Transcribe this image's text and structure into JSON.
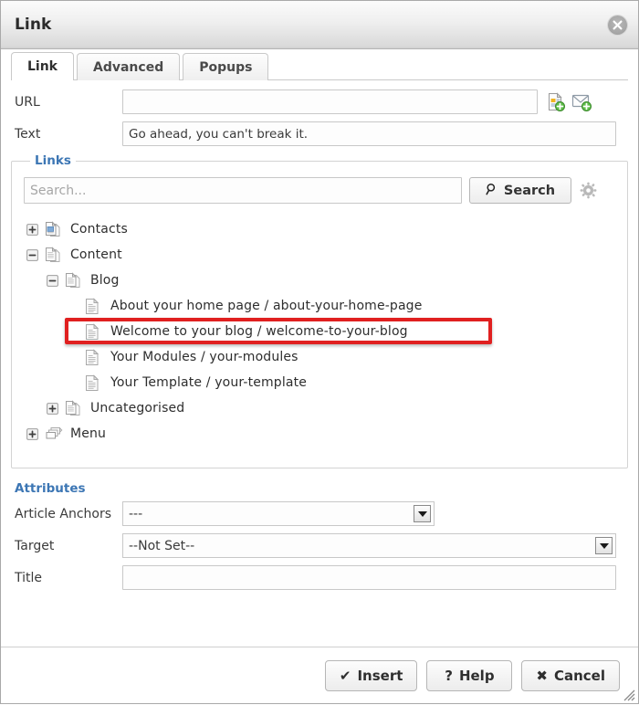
{
  "window": {
    "title": "Link",
    "close_icon": "close-circle-icon",
    "resize_grip_icon": "resize-grip-icon"
  },
  "tabs": [
    {
      "label": "Link",
      "active": true
    },
    {
      "label": "Advanced",
      "active": false
    },
    {
      "label": "Popups",
      "active": false
    }
  ],
  "form": {
    "url": {
      "label": "URL",
      "value": "",
      "placeholder": "",
      "icons": [
        {
          "name": "insert-article-icon"
        },
        {
          "name": "insert-email-icon"
        }
      ]
    },
    "text": {
      "label": "Text",
      "value": "Go ahead, you can't break it.",
      "placeholder": ""
    }
  },
  "links_panel": {
    "legend": "Links",
    "search": {
      "value": "",
      "placeholder": "Search...",
      "button_label": "Search",
      "button_icon": "magnifier-icon",
      "options_icon": "gear-icon"
    },
    "tree": [
      {
        "level": 0,
        "label": "Contacts",
        "toggle": "plus",
        "icon": "contacts-stack-icon",
        "highlighted": false
      },
      {
        "level": 0,
        "label": "Content",
        "toggle": "minus",
        "icon": "content-stack-icon",
        "highlighted": false
      },
      {
        "level": 1,
        "label": "Blog",
        "toggle": "minus",
        "icon": "content-stack-icon",
        "highlighted": false
      },
      {
        "level": 2,
        "label": "About your home page / about-your-home-page",
        "toggle": "none",
        "icon": "article-page-icon",
        "highlighted": false
      },
      {
        "level": 2,
        "label": "Welcome to your blog / welcome-to-your-blog",
        "toggle": "none",
        "icon": "article-page-icon",
        "highlighted": true
      },
      {
        "level": 2,
        "label": "Your Modules / your-modules",
        "toggle": "none",
        "icon": "article-page-icon",
        "highlighted": false
      },
      {
        "level": 2,
        "label": "Your Template / your-template",
        "toggle": "none",
        "icon": "article-page-icon",
        "highlighted": false
      },
      {
        "level": 1,
        "label": "Uncategorised",
        "toggle": "plus",
        "icon": "content-stack-icon",
        "highlighted": false
      },
      {
        "level": 0,
        "label": "Menu",
        "toggle": "plus",
        "icon": "menu-stack-icon",
        "highlighted": false
      }
    ]
  },
  "attributes": {
    "title": "Attributes",
    "article_anchors": {
      "label": "Article Anchors",
      "value": "---"
    },
    "target": {
      "label": "Target",
      "value": "--Not Set--"
    },
    "title_field": {
      "label": "Title",
      "value": "",
      "placeholder": ""
    }
  },
  "footer": {
    "insert": {
      "label": "Insert",
      "glyph": "✔"
    },
    "help": {
      "label": "Help",
      "glyph": "?"
    },
    "cancel": {
      "label": "Cancel",
      "glyph": "✖"
    }
  },
  "colors": {
    "accent_blue": "#3c76b4",
    "highlight_red": "#e02020",
    "titlebar_top": "#fbfbfb",
    "titlebar_bottom": "#d9d9d9"
  }
}
